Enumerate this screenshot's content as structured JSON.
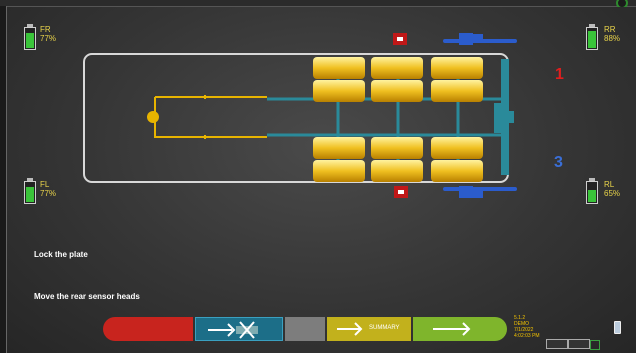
{
  "sensors": {
    "fr": {
      "label": "FR",
      "percent": "77%",
      "level": 0.77
    },
    "rr": {
      "label": "RR",
      "percent": "88%",
      "level": 0.88
    },
    "fl": {
      "label": "FL",
      "percent": "77%",
      "level": 0.77
    },
    "rl": {
      "label": "RL",
      "percent": "65%",
      "level": 0.65
    }
  },
  "markers": {
    "axle_one": "1",
    "axle_three": "3"
  },
  "instructions": {
    "line1": "Lock the plate",
    "line2": "Move the rear sensor heads"
  },
  "footer": {
    "summary_label": "SUMMARY"
  },
  "status": {
    "version": "5.1.2",
    "mode": "DEMO",
    "date": "7/1/2022",
    "time": "4:02:03 PM"
  },
  "colors": {
    "accent_yellow": "#e8b400",
    "frame_blue": "#2a8a9a",
    "marker_red": "#e01e1e",
    "marker_blue": "#3a6fd8"
  }
}
